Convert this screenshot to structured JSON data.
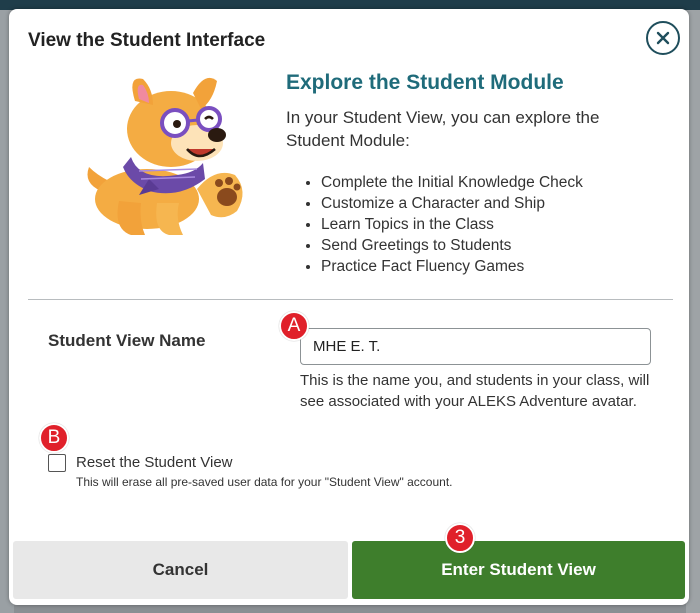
{
  "modal": {
    "title": "View the Student Interface",
    "close_icon": "close-icon"
  },
  "explore": {
    "heading": "Explore the Student Module",
    "intro": "In your Student View, you can explore the Student Module:",
    "features": [
      "Complete the Initial Knowledge Check",
      "Customize a Character and Ship",
      "Learn Topics in the Class",
      "Send Greetings to Students",
      "Practice Fact Fluency Games"
    ]
  },
  "student_view_name": {
    "label": "Student View Name",
    "value": "MHE E. T.",
    "help": "This is the name you, and students in your class, will see associated with your ALEKS Adventure avatar."
  },
  "reset": {
    "label": "Reset the Student View",
    "help": "This will erase all pre-saved user data for your \"Student View\" account.",
    "checked": false
  },
  "buttons": {
    "cancel": "Cancel",
    "enter": "Enter Student View"
  },
  "callouts": {
    "a": "A",
    "b": "B",
    "c": "3"
  },
  "colors": {
    "accent_heading": "#1f6b7a",
    "primary_button": "#3e7e2c",
    "callout_red": "#e0202a"
  }
}
